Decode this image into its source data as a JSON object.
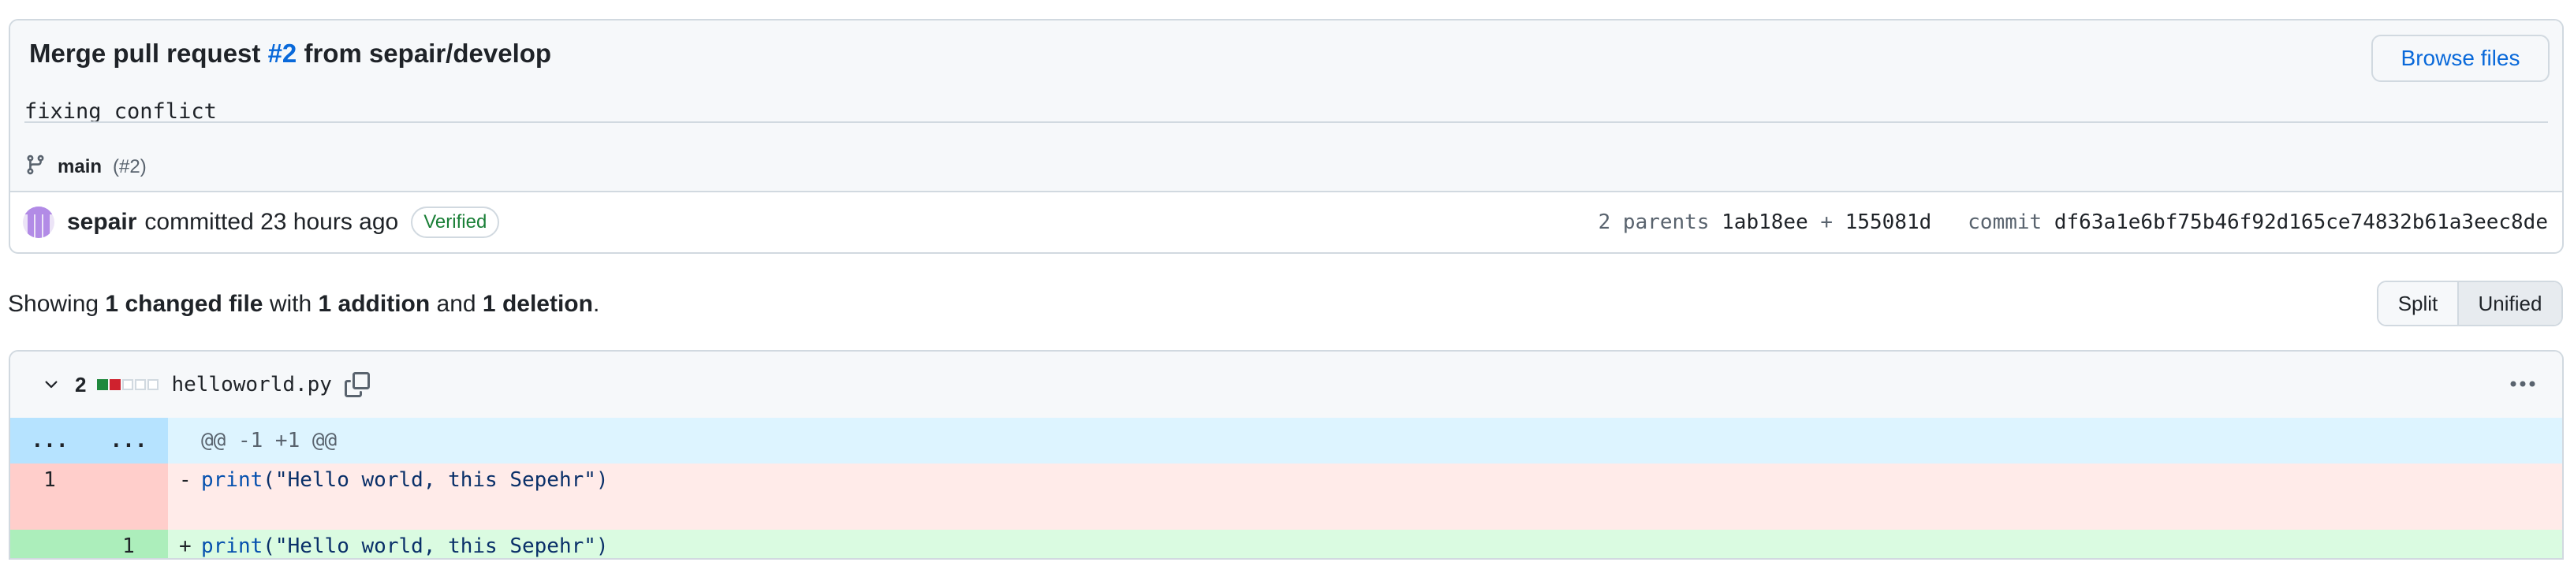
{
  "commit": {
    "title_prefix": "Merge pull request ",
    "title_pr": "#2",
    "title_suffix": " from sepair/develop",
    "description": "fixing conflict",
    "browse_label": "Browse files",
    "branch_name": "main",
    "branch_pr": "(#2)",
    "author": "sepair",
    "committed_text": "committed 23 hours ago",
    "verified_label": "Verified",
    "parents_label": "2 parents",
    "parent1": "1ab18ee",
    "parent_sep": " + ",
    "parent2": "155081d",
    "commit_label": "commit",
    "commit_sha": "df63a1e6bf75b46f92d165ce74832b61a3eec8de"
  },
  "summary": {
    "showing": "Showing ",
    "changed": "1 changed file",
    "with": " with ",
    "additions": "1 addition",
    "and": " and ",
    "deletions": "1 deletion",
    "end": "."
  },
  "view_toggle": {
    "split": "Split",
    "unified": "Unified",
    "selected": "Unified"
  },
  "diff": {
    "change_count": "2",
    "stat_blocks": [
      "add",
      "del",
      "neutral",
      "neutral",
      "neutral"
    ],
    "filename": "helloworld.py",
    "hunk": {
      "left": "...",
      "right": "...",
      "header": "@@ -1 +1 @@"
    },
    "deleted": {
      "old_line": "1",
      "sign": "-",
      "func": "print",
      "args": "(\"Hello world, this Sepehr\")"
    },
    "added": {
      "new_line": "1",
      "sign": "+",
      "func": "print",
      "args": "(\"Hello world, this Sepehr\")"
    }
  },
  "colors": {
    "link": "#0969da",
    "verified": "#1a7f37",
    "addition": "#1f883d",
    "deletion": "#cf222e",
    "hunk_bg": "#ddf4ff",
    "del_bg": "#ffebe9",
    "add_bg": "#dafbe1"
  },
  "icons": [
    "git-branch-icon",
    "avatar",
    "chevron-down-icon",
    "copy-icon",
    "kebab-icon",
    "no-entry-icon"
  ]
}
